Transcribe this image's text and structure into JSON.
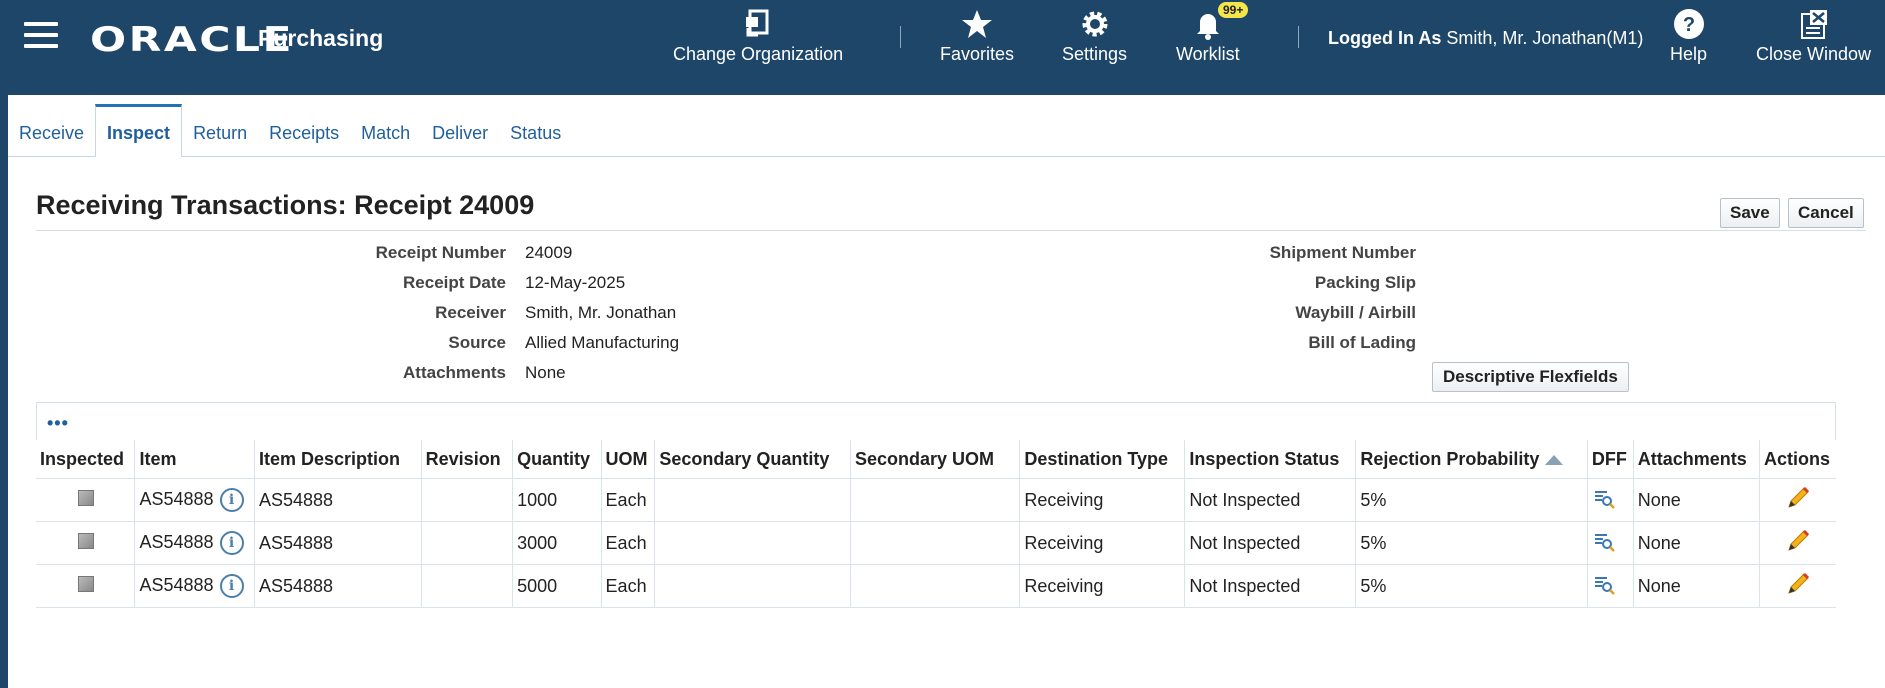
{
  "header": {
    "brand": "ORACLE",
    "app": "Purchasing",
    "change_org": "Change Organization",
    "favorites": "Favorites",
    "settings": "Settings",
    "worklist": "Worklist",
    "worklist_badge": "99+",
    "logged_in_label": "Logged In As",
    "logged_in_user": "Smith, Mr. Jonathan(M1)",
    "help": "Help",
    "close_window": "Close Window"
  },
  "tabs": [
    {
      "label": "Receive"
    },
    {
      "label": "Inspect",
      "active": true
    },
    {
      "label": "Return"
    },
    {
      "label": "Receipts"
    },
    {
      "label": "Match"
    },
    {
      "label": "Deliver"
    },
    {
      "label": "Status"
    }
  ],
  "page": {
    "title": "Receiving Transactions: Receipt 24009",
    "save": "Save",
    "cancel": "Cancel"
  },
  "details_left": [
    {
      "label": "Receipt Number",
      "value": "24009"
    },
    {
      "label": "Receipt Date",
      "value": "12-May-2025"
    },
    {
      "label": "Receiver",
      "value": "Smith, Mr. Jonathan"
    },
    {
      "label": "Source",
      "value": "Allied Manufacturing"
    },
    {
      "label": "Attachments",
      "value": "None"
    }
  ],
  "details_right": [
    {
      "label": "Shipment Number",
      "value": ""
    },
    {
      "label": "Packing Slip",
      "value": ""
    },
    {
      "label": "Waybill / Airbill",
      "value": ""
    },
    {
      "label": "Bill of Lading",
      "value": ""
    }
  ],
  "dff_button": "Descriptive Flexfields",
  "table": {
    "more_icon": "•••",
    "columns": [
      "Inspected",
      "Item",
      "Item Description",
      "Revision",
      "Quantity",
      "UOM",
      "Secondary Quantity",
      "Secondary UOM",
      "Destination Type",
      "Inspection Status",
      "Rejection Probability",
      "DFF",
      "Attachments",
      "Actions"
    ],
    "rows": [
      {
        "item": "AS54888",
        "description": "AS54888",
        "revision": "",
        "quantity": "1000",
        "uom": "Each",
        "sec_qty": "",
        "sec_uom": "",
        "dest_type": "Receiving",
        "insp_status": "Not Inspected",
        "rej_prob": "5%",
        "attachments": "None"
      },
      {
        "item": "AS54888",
        "description": "AS54888",
        "revision": "",
        "quantity": "3000",
        "uom": "Each",
        "sec_qty": "",
        "sec_uom": "",
        "dest_type": "Receiving",
        "insp_status": "Not Inspected",
        "rej_prob": "5%",
        "attachments": "None"
      },
      {
        "item": "AS54888",
        "description": "AS54888",
        "revision": "",
        "quantity": "5000",
        "uom": "Each",
        "sec_qty": "",
        "sec_uom": "",
        "dest_type": "Receiving",
        "insp_status": "Not Inspected",
        "rej_prob": "5%",
        "attachments": "None"
      }
    ]
  },
  "colors": {
    "header_bg": "#1d4669",
    "link": "#1f5f9d",
    "badge": "#f5e64a"
  }
}
